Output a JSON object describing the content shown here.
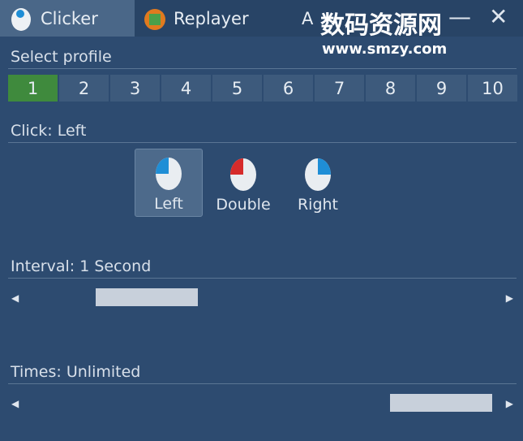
{
  "tabs": [
    {
      "label": "Clicker",
      "icon": "mouse-icon",
      "active": true
    },
    {
      "label": "Replayer",
      "icon": "replayer-icon",
      "active": false
    },
    {
      "label": "A",
      "icon": "about-icon",
      "active": false
    }
  ],
  "window": {
    "minimize": "—",
    "close": "✕"
  },
  "watermark": {
    "title": "数码资源网",
    "url": "www.smzy.com"
  },
  "profile": {
    "label": "Select profile",
    "options": [
      "1",
      "2",
      "3",
      "4",
      "5",
      "6",
      "7",
      "8",
      "9",
      "10"
    ],
    "selected": "1"
  },
  "click": {
    "label": "Click: Left",
    "options": [
      {
        "label": "Left",
        "color": "#1f8ed6"
      },
      {
        "label": "Double",
        "color": "#d62b2b"
      },
      {
        "label": "Right",
        "color": "#1f8ed6"
      }
    ],
    "selected": "Left"
  },
  "interval": {
    "label": "Interval: 1 Second",
    "position": 0.2
  },
  "times": {
    "label": "Times: Unlimited",
    "position": 1.0
  },
  "colors": {
    "accent": "#3f8a3d",
    "background": "#2d4b70"
  }
}
